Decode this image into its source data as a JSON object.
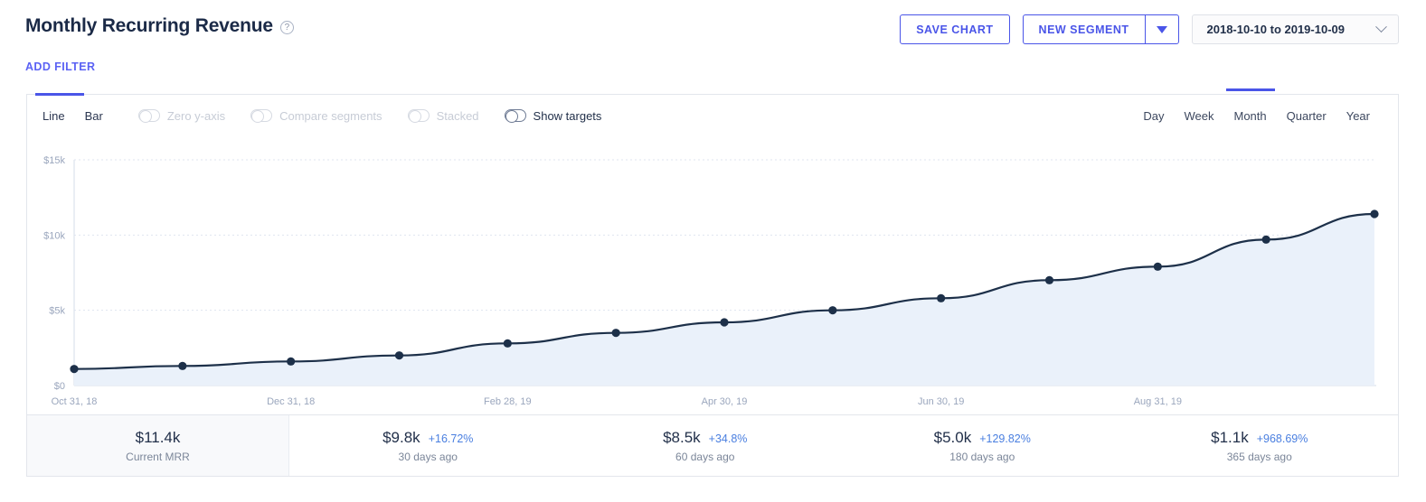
{
  "header": {
    "title": "Monthly Recurring Revenue",
    "help_icon": "question-mark-icon",
    "add_filter": "ADD FILTER",
    "save_chart": "SAVE CHART",
    "new_segment": "NEW SEGMENT",
    "new_segment_caret": "caret-down-icon",
    "date_range": "2018-10-10 to 2019-10-09",
    "date_range_chevron": "chevron-down-icon"
  },
  "controls": {
    "chart_types": [
      {
        "label": "Line",
        "active": true
      },
      {
        "label": "Bar",
        "active": false
      }
    ],
    "toggles": [
      {
        "label": "Zero y-axis",
        "on": false,
        "enabled": false
      },
      {
        "label": "Compare segments",
        "on": false,
        "enabled": false
      },
      {
        "label": "Stacked",
        "on": false,
        "enabled": false
      },
      {
        "label": "Show targets",
        "on": true,
        "enabled": true
      }
    ],
    "granularity": [
      {
        "label": "Day",
        "active": false
      },
      {
        "label": "Week",
        "active": false
      },
      {
        "label": "Month",
        "active": true
      },
      {
        "label": "Quarter",
        "active": false
      },
      {
        "label": "Year",
        "active": false
      }
    ]
  },
  "stats": [
    {
      "value": "$11.4k",
      "delta": "",
      "label": "Current MRR",
      "current": true
    },
    {
      "value": "$9.8k",
      "delta": "+16.72%",
      "label": "30 days ago",
      "current": false
    },
    {
      "value": "$8.5k",
      "delta": "+34.8%",
      "label": "60 days ago",
      "current": false
    },
    {
      "value": "$5.0k",
      "delta": "+129.82%",
      "label": "180 days ago",
      "current": false
    },
    {
      "value": "$1.1k",
      "delta": "+968.69%",
      "label": "365 days ago",
      "current": false
    }
  ],
  "colors": {
    "accent": "#4a55e8",
    "link": "#5b62f4",
    "line": "#1d3049",
    "area": "#eaf1fa",
    "delta": "#4a7fe0",
    "axis_text": "#9aa6bd"
  },
  "chart_data": {
    "type": "area",
    "title": "Monthly Recurring Revenue",
    "xlabel": "",
    "ylabel": "",
    "ylim": [
      0,
      15000
    ],
    "yticks": [
      0,
      5000,
      10000,
      15000
    ],
    "ytick_labels": [
      "$0",
      "$5k",
      "$10k",
      "$15k"
    ],
    "grid": true,
    "legend": "none",
    "xtick_labels": [
      "Oct 31, 18",
      "Dec 31, 18",
      "Feb 28, 19",
      "Apr 30, 19",
      "Jun 30, 19",
      "Aug 31, 19"
    ],
    "x": [
      "Oct 31, 18",
      "Nov 30, 18",
      "Dec 31, 18",
      "Jan 31, 19",
      "Feb 28, 19",
      "Mar 31, 19",
      "Apr 30, 19",
      "May 31, 19",
      "Jun 30, 19",
      "Jul 31, 19",
      "Aug 31, 19",
      "Sep 30, 19",
      "Oct 09, 19"
    ],
    "series": [
      {
        "name": "MRR",
        "values": [
          1100,
          1300,
          1600,
          2000,
          2800,
          3500,
          4200,
          5000,
          5800,
          7000,
          7900,
          9700,
          11400
        ]
      }
    ]
  }
}
